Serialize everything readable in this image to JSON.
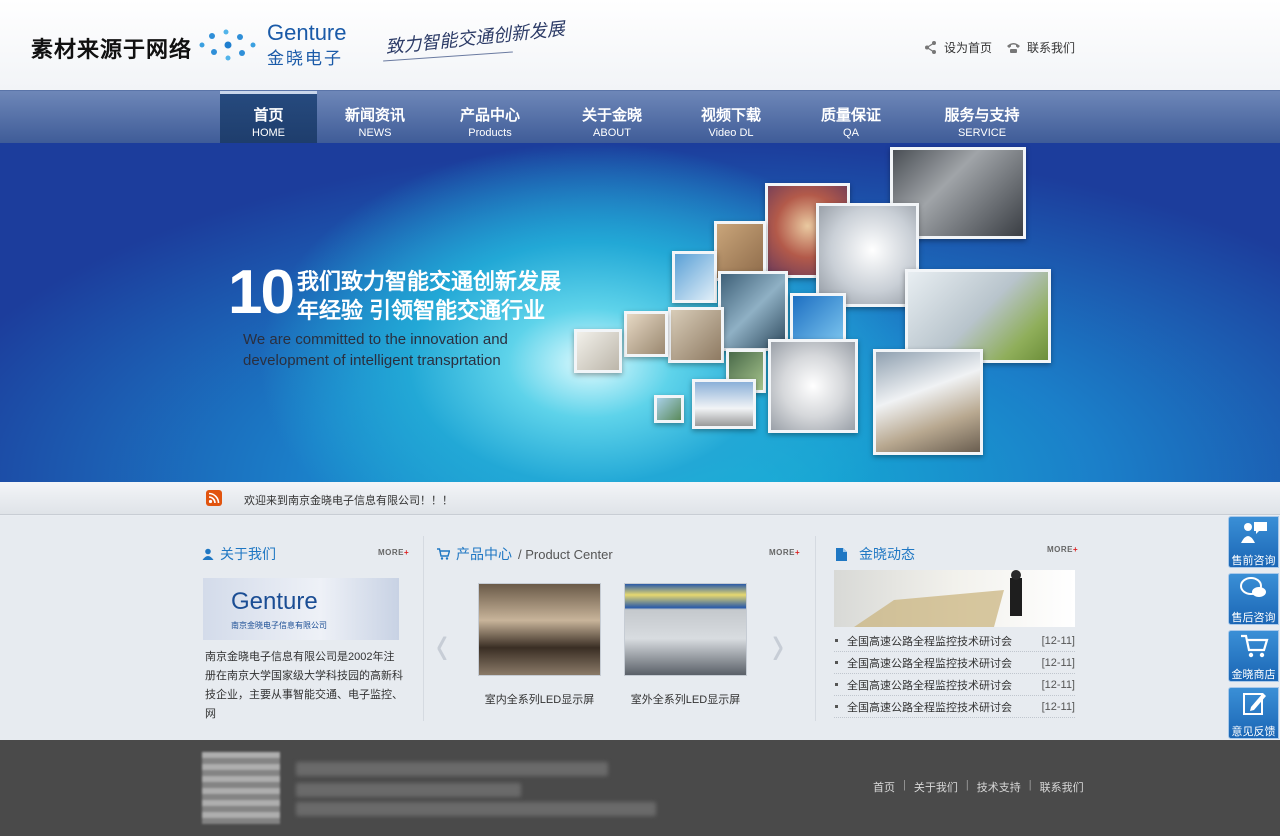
{
  "header": {
    "watermark": "素材来源于网络",
    "logo_en": "Genture",
    "logo_cn": "金晓电子",
    "slogan": "致力智能交通创新发展",
    "set_home": "设为首页",
    "contact": "联系我们"
  },
  "nav": [
    {
      "cn": "首页",
      "en": "HOME"
    },
    {
      "cn": "新闻资讯",
      "en": "NEWS"
    },
    {
      "cn": "产品中心",
      "en": "Products"
    },
    {
      "cn": "关于金晓",
      "en": "ABOUT"
    },
    {
      "cn": "视频下载",
      "en": "Video DL"
    },
    {
      "cn": "质量保证",
      "en": "QA"
    },
    {
      "cn": "服务与支持",
      "en": "SERVICE"
    }
  ],
  "banner": {
    "number": "10",
    "line1": "我们致力智能交通创新发展",
    "line2": "年经验  引领智能交通行业",
    "en1": "We are committed to the innovation and",
    "en2": "development of intelligent transprtation"
  },
  "notice": {
    "text": "欢迎来到南京金晓电子信息有限公司！！！"
  },
  "about": {
    "title": "关于我们",
    "more": "MORE",
    "img_en": "Genture",
    "img_sub": "南京金晓电子信息有限公司",
    "text": "南京金晓电子信息有限公司是2002年注册在南京大学国家级大学科技园的高新科技企业，主要从事智能交通、电子监控、网"
  },
  "products": {
    "title": "产品中心",
    "subtitle": "/ Product Center",
    "more": "MORE",
    "items": [
      {
        "caption": "室内全系列LED显示屏"
      },
      {
        "caption": "室外全系列LED显示屏"
      }
    ],
    "prev": "‹",
    "next": "›"
  },
  "news": {
    "title": "金晓动态",
    "more": "MORE",
    "items": [
      {
        "title": "全国高速公路全程监控技术研讨会",
        "date": "[12-11]"
      },
      {
        "title": "全国高速公路全程监控技术研讨会",
        "date": "[12-11]"
      },
      {
        "title": "全国高速公路全程监控技术研讨会",
        "date": "[12-11]"
      },
      {
        "title": "全国高速公路全程监控技术研讨会",
        "date": "[12-11]"
      }
    ]
  },
  "float": [
    {
      "label": "售前咨询",
      "icon": "person-chat-icon"
    },
    {
      "label": "售后咨询",
      "icon": "chat-bubbles-icon"
    },
    {
      "label": "金晓商店",
      "icon": "cart-icon"
    },
    {
      "label": "意见反馈",
      "icon": "pencil-icon"
    }
  ],
  "footer": {
    "links": [
      "首页",
      "关于我们",
      "技术支持",
      "联系我们"
    ]
  },
  "colors": {
    "nav": "#4f6ba3",
    "accent": "#1f77c3",
    "footer": "#4a4a4a"
  }
}
